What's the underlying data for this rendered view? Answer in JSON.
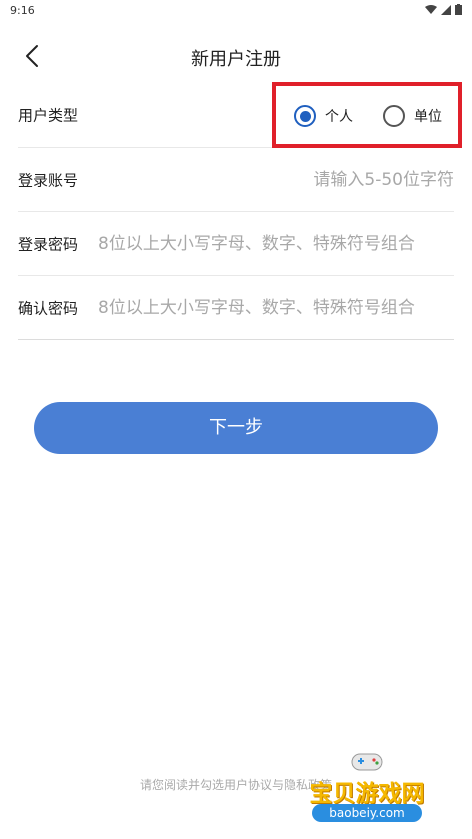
{
  "status_bar": {
    "time": "9:16"
  },
  "header": {
    "title": "新用户注册"
  },
  "user_type": {
    "label": "用户类型",
    "options": [
      {
        "label": "个人",
        "checked": true
      },
      {
        "label": "单位",
        "checked": false
      }
    ]
  },
  "login_account": {
    "label": "登录账号",
    "placeholder": "请输入5-50位字符"
  },
  "login_password": {
    "label": "登录密码",
    "placeholder": "8位以上大小写字母、数字、特殊符号组合"
  },
  "confirm_password": {
    "label": "确认密码",
    "placeholder": "8位以上大小写字母、数字、特殊符号组合"
  },
  "next_button": {
    "label": "下一步"
  },
  "agreement": {
    "text": "请您阅读并勾选用户协议与隐私政策"
  },
  "watermark": {
    "text": "宝贝游戏网",
    "url": "baobeiy.com"
  },
  "colors": {
    "accent": "#4a7fd4",
    "radio": "#1f5fbf",
    "highlight_box": "#e0202a"
  }
}
